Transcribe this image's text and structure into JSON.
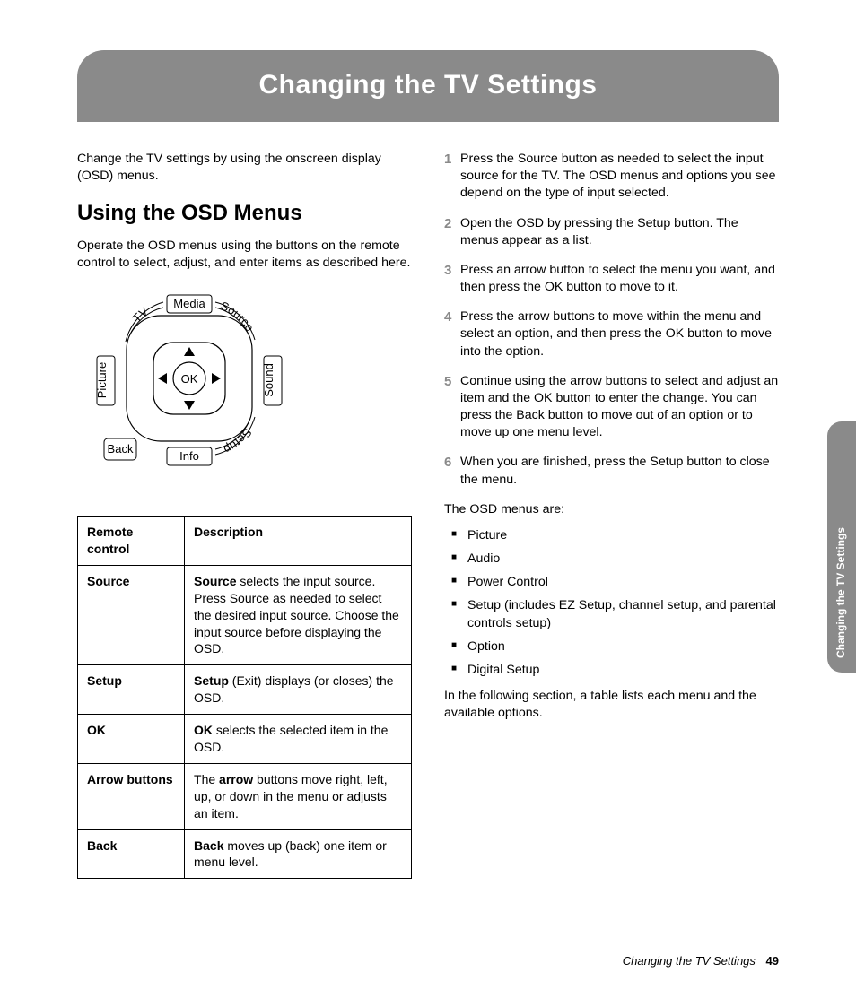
{
  "banner_title": "Changing the TV Settings",
  "intro": "Change the TV settings by using the onscreen display (OSD) menus.",
  "section_heading": "Using the OSD Menus",
  "section_intro": "Operate the OSD menus using the buttons on the remote control to select, adjust, and enter items as described here.",
  "diagram": {
    "media": "Media",
    "info": "Info",
    "picture": "Picture",
    "sound": "Sound",
    "tv": "TV",
    "source": "Source",
    "setup": "Setup",
    "back": "Back",
    "ok": "OK"
  },
  "table": {
    "head_remote": "Remote control",
    "head_desc": "Description",
    "rows": [
      {
        "name": "Source",
        "bold": "Source",
        "rest": " selects the input source. Press Source as needed to select the desired input source. Choose the input source before displaying the OSD."
      },
      {
        "name": "Setup",
        "bold": "Setup",
        "rest": " (Exit) displays (or closes) the OSD."
      },
      {
        "name": "OK",
        "bold": "OK",
        "rest": " selects the selected item in the OSD."
      },
      {
        "name": "Arrow buttons",
        "bold": "arrow",
        "prefix": "The ",
        "rest": " buttons move right, left, up, or down in the menu or adjusts an item."
      },
      {
        "name": "Back",
        "bold": "Back",
        "rest": " moves up (back) one item or menu level."
      }
    ]
  },
  "steps": [
    "Press the Source button as needed to select the input source for the TV. The OSD menus and options you see depend on the type of input selected.",
    "Open the OSD by pressing the Setup button. The menus appear as a list.",
    "Press an arrow button to select the menu you want, and then press the OK button to move to it.",
    "Press the arrow buttons to move within the menu and select an option, and then press the OK button to move into the option.",
    "Continue using the arrow buttons to select and adjust an item and the OK button to enter the change. You can press the Back button to move out of an option or to move up one menu level.",
    "When you are finished, press the Setup button to close the menu."
  ],
  "menus_intro": "The OSD menus are:",
  "menus": [
    "Picture",
    "Audio",
    "Power Control",
    "Setup (includes EZ Setup, channel setup, and parental controls setup)",
    "Option",
    "Digital Setup"
  ],
  "closing": "In the following section, a table lists each menu and the available options.",
  "side_tab": "Changing the TV Settings",
  "footer_title": "Changing the TV Settings",
  "page_number": "49"
}
